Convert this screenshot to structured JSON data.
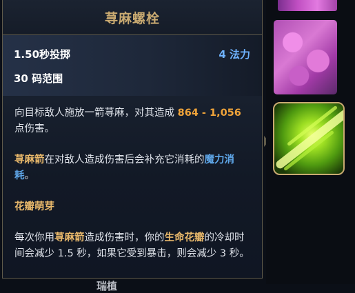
{
  "ability": {
    "name": "荨麻螺栓",
    "cast_time": "1.50秒投掷",
    "cost": "4 法力",
    "range": "30 码范围"
  },
  "description": {
    "p1_before": "向目标敌人施放一箭荨麻，对其造成 ",
    "p1_damage": "864 - 1,056",
    "p1_after": " 点伤害。",
    "p2_kw": "荨麻箭",
    "p2_mid": "在对敌人造成伤害后会补充它消耗的",
    "p2_blue": "魔力消耗",
    "p2_end": "。",
    "talent_name": "花瓣萌芽",
    "t_a": "每次你用",
    "t_kw1": "荨麻箭",
    "t_b": "造成伤害时，你的",
    "t_kw2": "生命花瓣",
    "t_c": "的冷却时间会减少 1.5 秒，如果它受到暴击，则会减少 3 秒。"
  },
  "bottom_fragment": "瑞植",
  "icons": {
    "top_icon": "pink-ability-icon",
    "flower_icon": "flower-petal-icon",
    "selected_icon": "nettle-bolt-icon"
  },
  "colors": {
    "title": "#c9aa71",
    "damage": "#f0a43a",
    "keyword": "#e8b86b",
    "mana": "#6fb3ff"
  }
}
